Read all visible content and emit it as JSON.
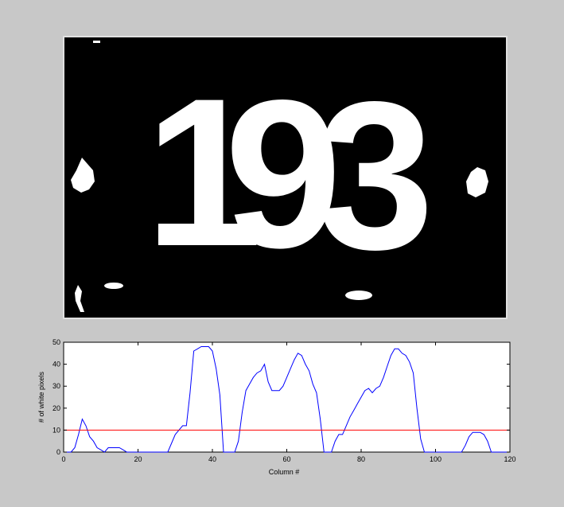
{
  "image_panel": {
    "digits": [
      "1",
      "9",
      "3"
    ],
    "background": "#000000",
    "foreground": "#ffffff"
  },
  "chart_data": {
    "type": "line",
    "title": "",
    "xlabel": "Column #",
    "ylabel": "# of white pixels",
    "xlim": [
      0,
      120
    ],
    "ylim": [
      0,
      50
    ],
    "xticks": [
      0,
      20,
      40,
      60,
      80,
      100,
      120
    ],
    "yticks": [
      0,
      10,
      20,
      30,
      40,
      50
    ],
    "grid": false,
    "series": [
      {
        "color": "#0000ff",
        "x": [
          0,
          1,
          2,
          3,
          4,
          5,
          6,
          7,
          8,
          9,
          10,
          11,
          12,
          13,
          14,
          15,
          16,
          17,
          18,
          19,
          20,
          21,
          22,
          23,
          24,
          25,
          26,
          27,
          28,
          29,
          30,
          31,
          32,
          33,
          34,
          35,
          36,
          37,
          38,
          39,
          40,
          41,
          42,
          43,
          44,
          45,
          46,
          47,
          48,
          49,
          50,
          51,
          52,
          53,
          54,
          55,
          56,
          57,
          58,
          59,
          60,
          61,
          62,
          63,
          64,
          65,
          66,
          67,
          68,
          69,
          70,
          71,
          72,
          73,
          74,
          75,
          76,
          77,
          78,
          79,
          80,
          81,
          82,
          83,
          84,
          85,
          86,
          87,
          88,
          89,
          90,
          91,
          92,
          93,
          94,
          95,
          96,
          97,
          98,
          99,
          100,
          101,
          102,
          103,
          104,
          105,
          106,
          107,
          108,
          109,
          110,
          111,
          112,
          113,
          114,
          115,
          116,
          117,
          118,
          119,
          120
        ],
        "y": [
          0,
          0,
          0,
          2,
          8,
          15,
          12,
          7,
          5,
          2,
          1,
          0,
          2,
          2,
          2,
          2,
          1,
          0,
          0,
          0,
          0,
          0,
          0,
          0,
          0,
          0,
          0,
          0,
          0,
          4,
          8,
          10,
          12,
          12,
          27,
          46,
          47,
          48,
          48,
          48,
          46,
          38,
          26,
          0,
          0,
          0,
          0,
          5,
          18,
          28,
          31,
          34,
          36,
          37,
          40,
          32,
          28,
          28,
          28,
          30,
          34,
          38,
          42,
          45,
          44,
          40,
          37,
          31,
          27,
          15,
          0,
          0,
          0,
          5,
          8,
          8,
          12,
          16,
          19,
          22,
          25,
          28,
          29,
          27,
          29,
          30,
          34,
          39,
          44,
          47,
          47,
          45,
          44,
          41,
          36,
          20,
          6,
          0,
          0,
          0,
          0,
          0,
          0,
          0,
          0,
          0,
          0,
          0,
          3,
          7,
          9,
          9,
          9,
          8,
          5,
          0,
          0,
          0,
          0,
          0,
          0
        ]
      },
      {
        "color": "#ff0000",
        "x": [
          0,
          120
        ],
        "y": [
          10,
          10
        ]
      }
    ]
  }
}
